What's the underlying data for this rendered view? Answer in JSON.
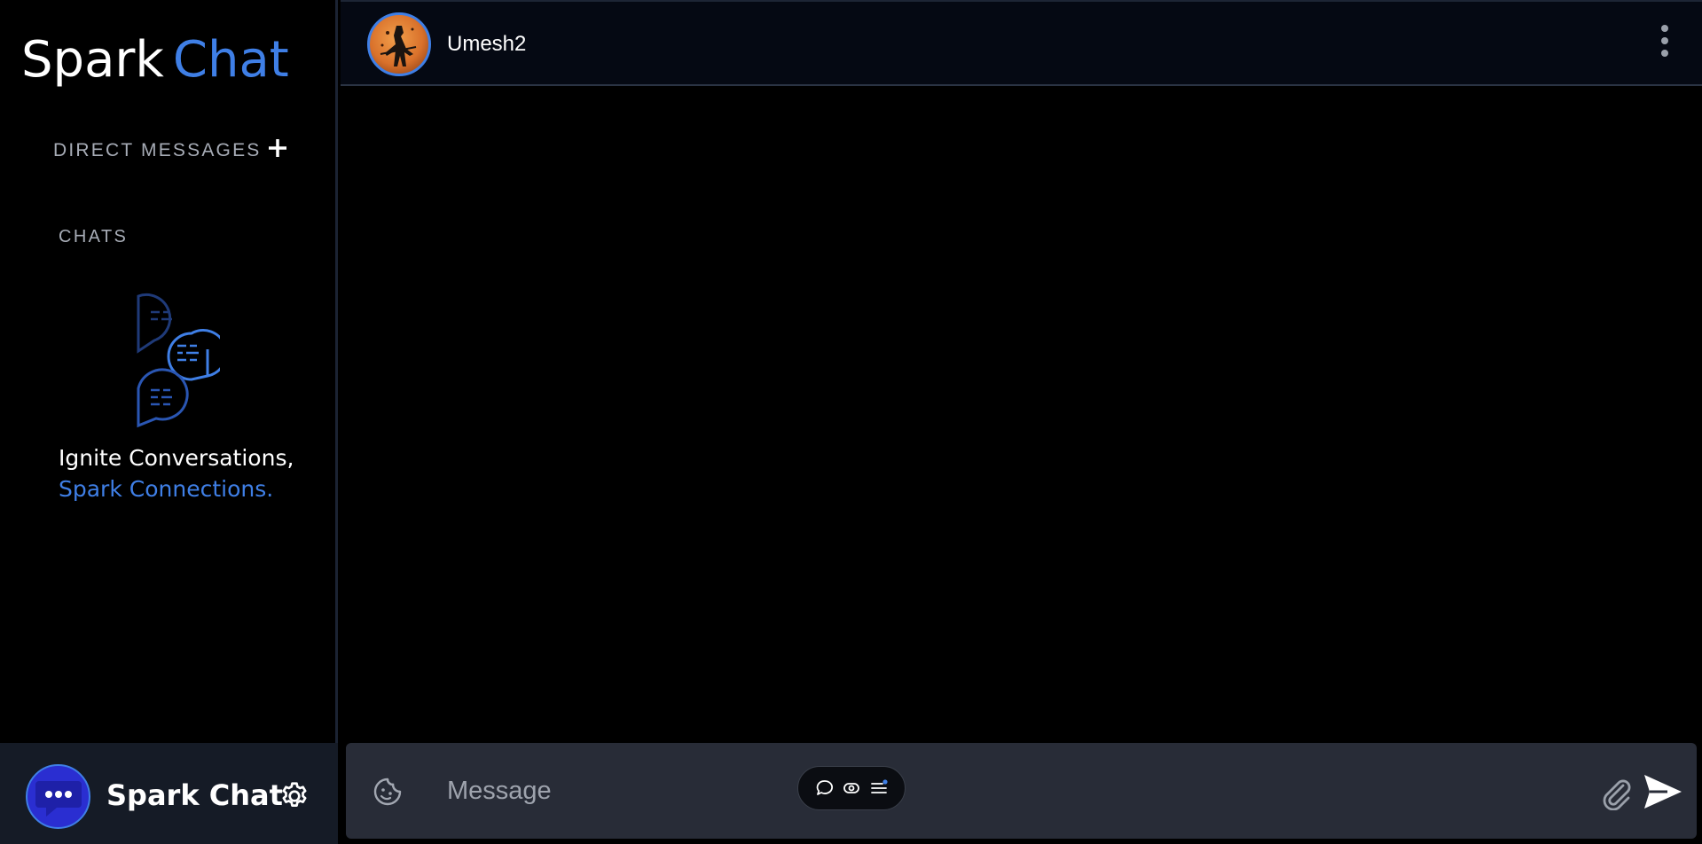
{
  "sidebar": {
    "logo_part1": "Spark",
    "logo_part2": "Chat",
    "direct_messages_label": "DIRECT MESSAGES",
    "chats_label": "CHATS",
    "tagline_line1": "Ignite Conversations,",
    "tagline_line2": "Spark Connections.",
    "profile_name": "Spark Chat"
  },
  "chat": {
    "contact_name": "Umesh2"
  },
  "composer": {
    "placeholder": "Message"
  },
  "icons": {
    "add": "plus-icon",
    "settings": "gear-icon",
    "menu": "kebab-menu-icon",
    "sticker": "sticker-icon",
    "attach": "paperclip-icon",
    "send": "send-icon",
    "empty_state": "chat-bubbles-icon"
  },
  "colors": {
    "accent": "#3f7fe6",
    "background": "#000000",
    "panel": "#151b26",
    "composer": "#282c37",
    "header": "#050913",
    "muted_text": "#a7acb6"
  }
}
